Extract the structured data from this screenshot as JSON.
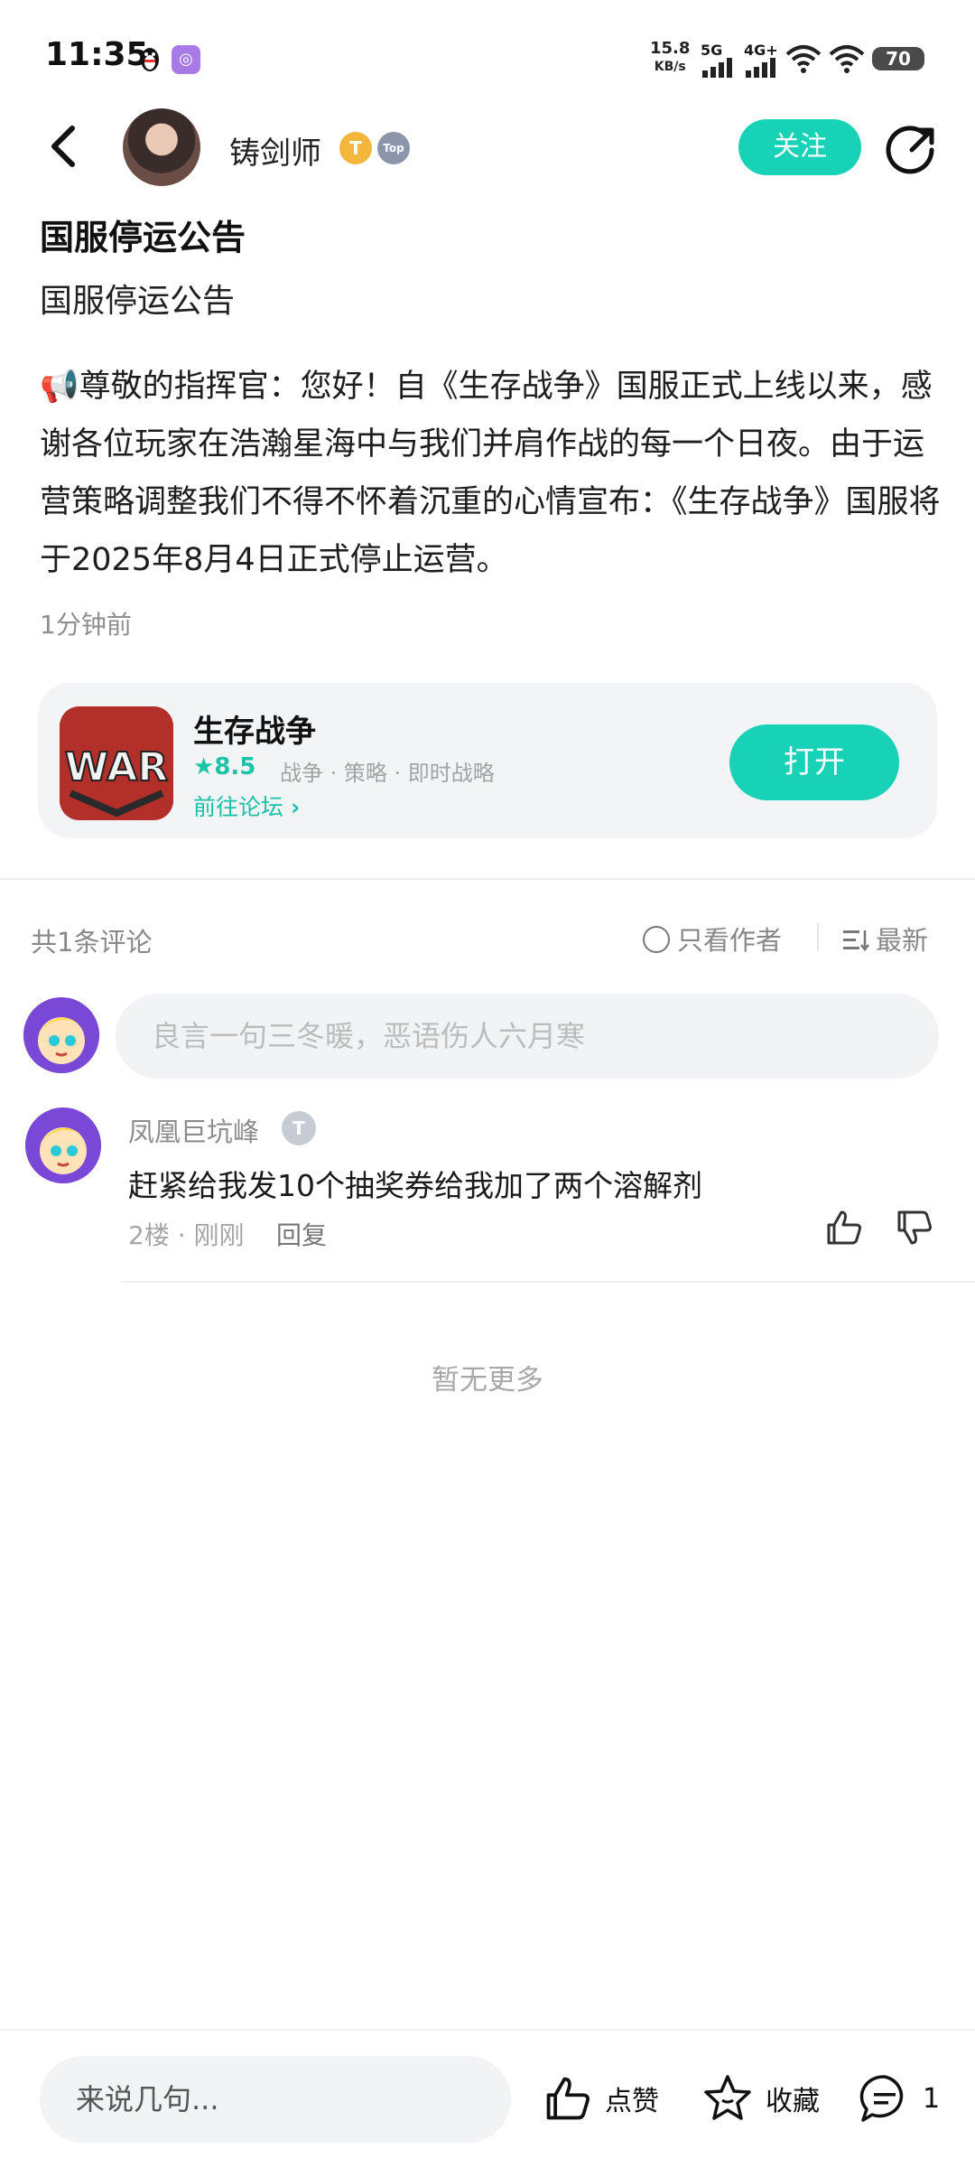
{
  "status_bar": {
    "time": "11:35",
    "net_speed_value": "15.8",
    "net_speed_unit": "KB/s",
    "network_1": "5G",
    "network_2": "4G+",
    "battery": "70"
  },
  "header": {
    "author_name": "铸剑师",
    "badge_t": "T",
    "badge_top": "Top",
    "follow_label": "关注"
  },
  "post": {
    "title": "国服停运公告",
    "subtitle": "国服停运公告",
    "body": "📢尊敬的指挥官：您好！自《生存战争》国服正式上线以来，感谢各位玩家在浩瀚星海中与我们并肩作战的每一个日夜。由于运营策略调整我们不得不怀着沉重的心情宣布：《生存战争》国服将于2025年8月4日正式停止运营。",
    "time": "1分钟前"
  },
  "game_card": {
    "icon_text": "WAR",
    "name": "生存战争",
    "rating": "8.5",
    "tags": "战争 · 策略 · 即时战略",
    "forum_link": "前往论坛",
    "open_label": "打开"
  },
  "comments_header": {
    "count_label": "共1条评论",
    "only_author_label": "只看作者",
    "sort_label": "最新"
  },
  "comment_input": {
    "placeholder": "良言一句三冬暖，恶语伤人六月寒"
  },
  "comments": [
    {
      "user": "凤凰巨坑峰",
      "badge": "T",
      "text": "赶紧给我发10个抽奖券给我加了两个溶解剂",
      "floor_time": "2楼 · 刚刚",
      "reply_label": "回复"
    }
  ],
  "no_more_label": "暂无更多",
  "bottom_bar": {
    "input_placeholder": "来说几句...",
    "like_label": "点赞",
    "favorite_label": "收藏",
    "comment_count": "1"
  }
}
